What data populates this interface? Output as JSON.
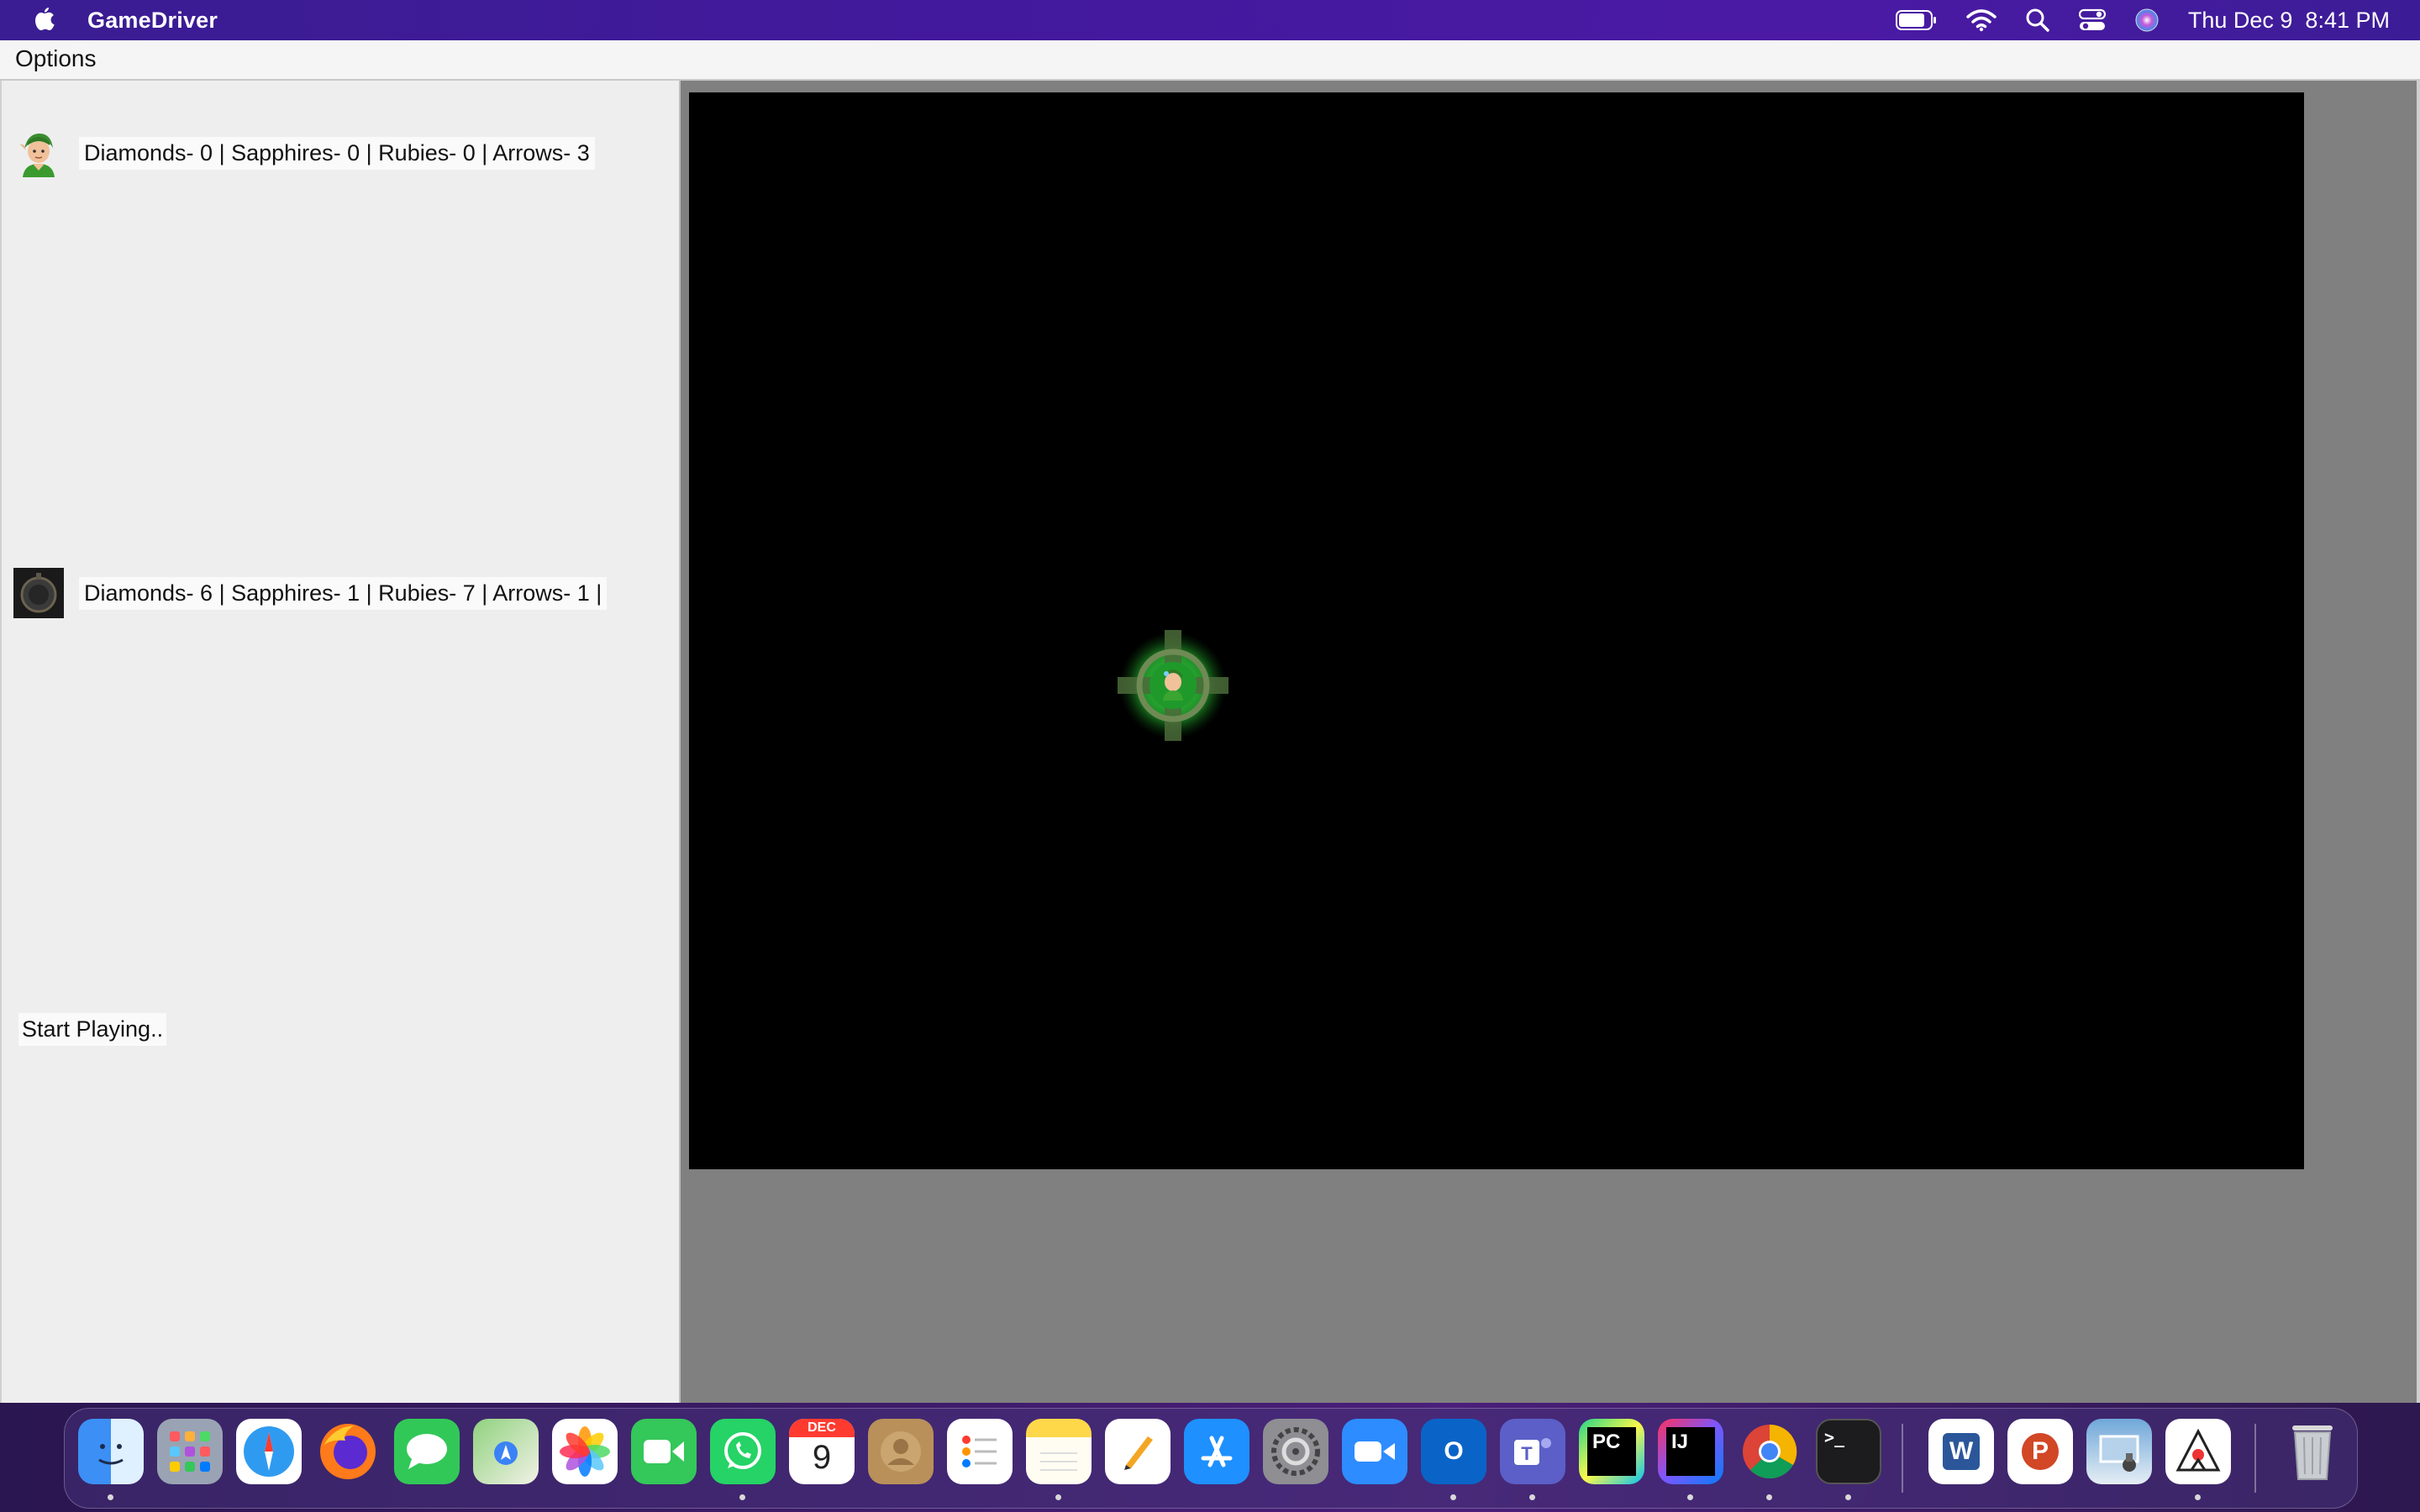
{
  "menubar": {
    "app_name": "GameDriver",
    "clock": "Thu Dec 9  8:41 PM"
  },
  "window": {
    "menu": {
      "options_label": "Options"
    },
    "players": [
      {
        "stats": "Diamonds- 0 | Sapphires- 0 | Rubies- 0 | Arrows- 3"
      },
      {
        "stats": "Diamonds- 6 | Sapphires- 1 | Rubies- 7 | Arrows- 1 |"
      }
    ],
    "status": "Start Playing.."
  },
  "dock": {
    "calendar_month": "DEC",
    "calendar_day": "9",
    "apps": [
      "finder-icon",
      "launchpad-icon",
      "safari-icon",
      "firefox-icon",
      "messages-icon",
      "maps-icon",
      "photos-icon",
      "facetime-icon",
      "whatsapp-icon",
      "calendar-icon",
      "contacts-icon",
      "reminders-icon",
      "notes-icon",
      "pages-icon",
      "app-store-icon",
      "system-preferences-icon",
      "zoom-icon",
      "outlook-icon",
      "teams-icon",
      "pycharm-icon",
      "intellij-icon",
      "chrome-icon",
      "terminal-icon",
      "word-icon",
      "powerpoint-icon",
      "preview-icon",
      "java-icon",
      "trash-icon"
    ],
    "labels": {
      "pycharm": "PC",
      "intellij": "IJ",
      "outlook": "O",
      "word": "W",
      "powerpoint": "P",
      "terminal": ">_"
    }
  },
  "colors": {
    "board": "#000000",
    "board_frame": "#808080",
    "menubar_purple": "#42199c",
    "player_green": "#2e9e3a"
  }
}
